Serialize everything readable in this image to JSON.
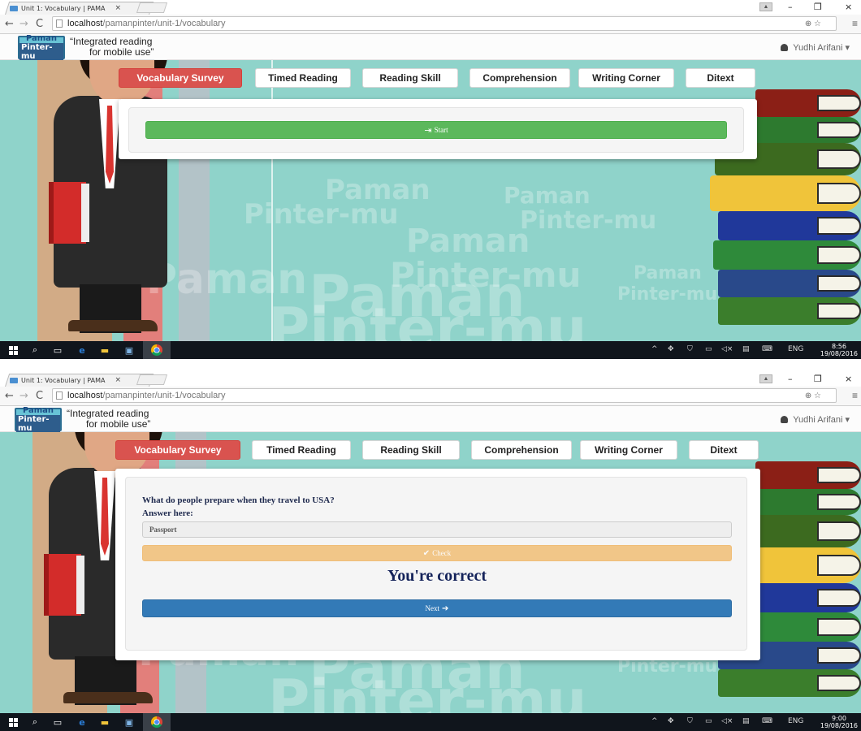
{
  "screens": [
    {
      "tab_title": "Unit 1: Vocabulary | PAMA",
      "url_host": "localhost",
      "url_path": "/pamanpinter/unit-1/vocabulary",
      "logo_line1": "Paman",
      "logo_line2": "Pinter-mu",
      "tagline_line1": "“Integrated reading",
      "tagline_line2": "for mobile use”",
      "user_name": "Yudhi Arifani",
      "user_caret": "▾",
      "nav_tabs": [
        "Vocabulary Survey",
        "Timed Reading",
        "Reading Skill",
        "Comprehension",
        "Writing Corner",
        "Ditext"
      ],
      "active_tab": "Vocabulary Survey",
      "start_label": "Start",
      "taskbar_lang": "ENG",
      "clock_time": "8:56",
      "clock_date": "19/08/2016"
    },
    {
      "tab_title": "Unit 1: Vocabulary | PAMA",
      "url_host": "localhost",
      "url_path": "/pamanpinter/unit-1/vocabulary",
      "logo_line1": "Paman",
      "logo_line2": "Pinter-mu",
      "tagline_line1": "“Integrated reading",
      "tagline_line2": "for mobile use”",
      "user_name": "Yudhi Arifani",
      "user_caret": "▾",
      "nav_tabs": [
        "Vocabulary Survey",
        "Timed Reading",
        "Reading Skill",
        "Comprehension",
        "Writing Corner",
        "Ditext"
      ],
      "active_tab": "Vocabulary Survey",
      "question": "What do people prepare when they travel to USA?",
      "answer_label": "Answer here:",
      "answer_value": "Passport",
      "check_label": "Check",
      "result_text": "You're correct",
      "next_label": "Next",
      "taskbar_lang": "ENG",
      "clock_time": "9:00",
      "clock_date": "19/08/2016"
    }
  ],
  "colors": {
    "background_teal": "#8fd3ca",
    "active_tab_red": "#d9534f",
    "start_green": "#5cb85c",
    "check_orange": "#f0ad4e",
    "next_blue": "#337ab7",
    "result_navy": "#15235a",
    "taskbar": "#10151c"
  },
  "icons": {
    "start": "sign-in-icon",
    "check": "checkmark-icon",
    "next": "arrow-right-icon",
    "user": "user-icon"
  }
}
